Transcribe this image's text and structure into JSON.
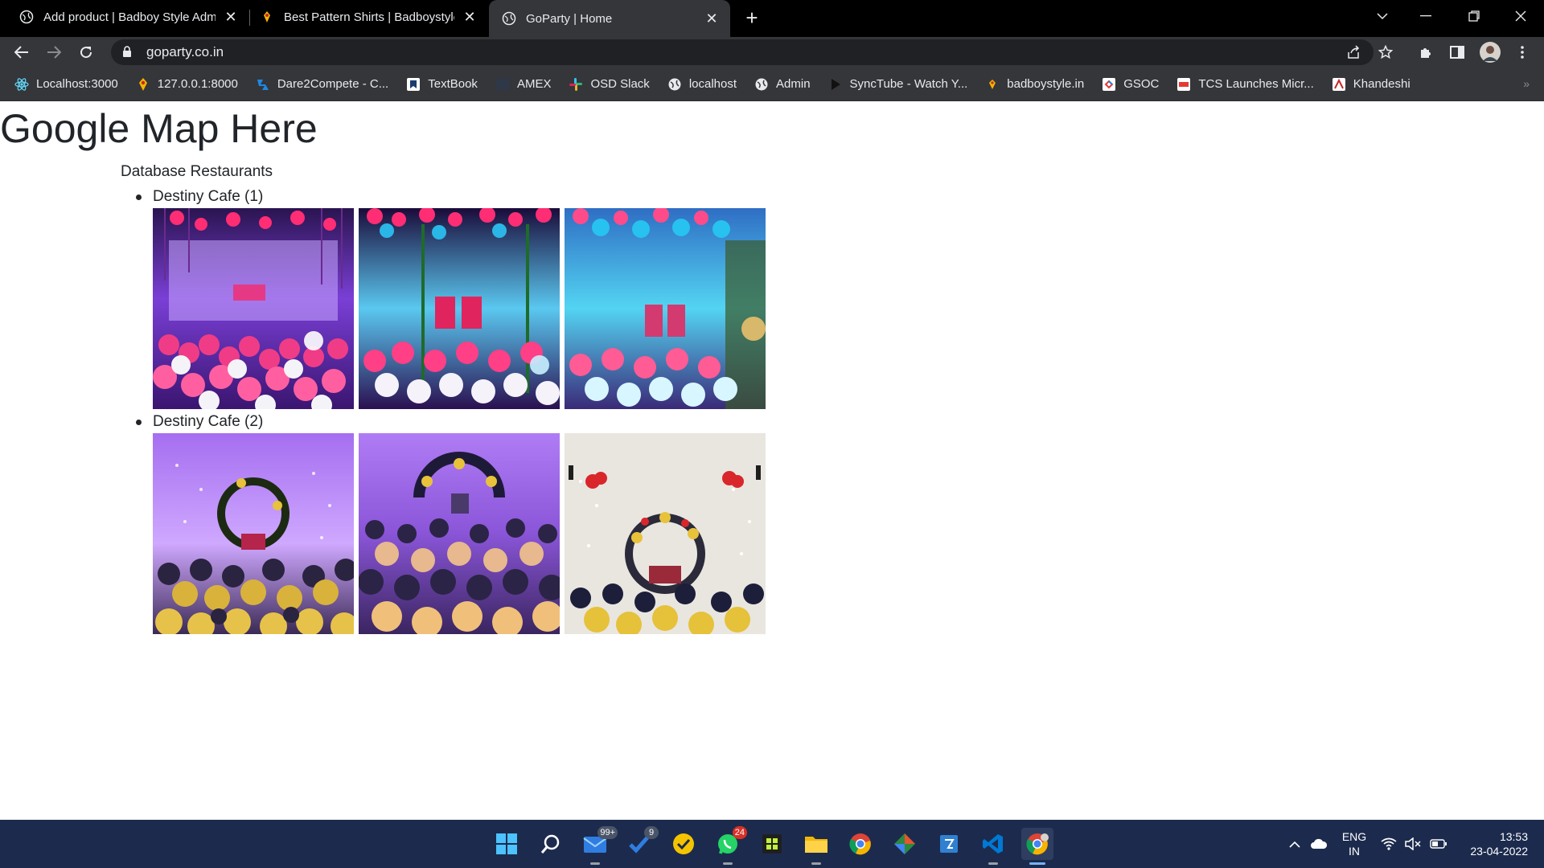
{
  "browser": {
    "tabs": [
      {
        "title": "Add product | Badboy Style Adm",
        "favicon": "globe-icon",
        "active": false
      },
      {
        "title": "Best Pattern Shirts | Badboystyle",
        "favicon": "badboy-icon",
        "active": false
      },
      {
        "title": "GoParty | Home",
        "favicon": "globe-icon",
        "active": true
      }
    ],
    "url": "goparty.co.in",
    "bookmarks": [
      {
        "label": "Localhost:3000",
        "icon": "react-icon"
      },
      {
        "label": "127.0.0.1:8000",
        "icon": "badboy-icon"
      },
      {
        "label": "Dare2Compete - C...",
        "icon": "d2c-icon"
      },
      {
        "label": "TextBook",
        "icon": "textbook-icon"
      },
      {
        "label": "AMEX",
        "icon": "amex-icon"
      },
      {
        "label": "OSD Slack",
        "icon": "slack-icon"
      },
      {
        "label": "localhost",
        "icon": "globe-icon"
      },
      {
        "label": "Admin",
        "icon": "globe-icon"
      },
      {
        "label": "SyncTube - Watch Y...",
        "icon": "play-icon"
      },
      {
        "label": "badboystyle.in",
        "icon": "badboy-icon"
      },
      {
        "label": "GSOC",
        "icon": "gsoc-icon"
      },
      {
        "label": "TCS Launches Micr...",
        "icon": "tcs-icon"
      },
      {
        "label": "Khandeshi",
        "icon": "khandeshi-icon"
      }
    ]
  },
  "page": {
    "heading": "Google Map Here",
    "section_title": "Database Restaurants",
    "restaurants": [
      {
        "name": "Destiny Cafe (1)",
        "photo_theme": "pink-blue-balloons"
      },
      {
        "name": "Destiny Cafe (2)",
        "photo_theme": "gold-black-balloons"
      }
    ]
  },
  "taskbar": {
    "apps": [
      {
        "name": "start-icon"
      },
      {
        "name": "search-icon"
      },
      {
        "name": "mail-icon",
        "badge": "99+"
      },
      {
        "name": "todo-icon",
        "badge": "9"
      },
      {
        "name": "tasks-icon"
      },
      {
        "name": "whatsapp-icon",
        "badge": "24"
      },
      {
        "name": "app-icon"
      },
      {
        "name": "folder-icon"
      },
      {
        "name": "chrome-icon"
      },
      {
        "name": "git-icon"
      },
      {
        "name": "store-icon"
      },
      {
        "name": "vscode-icon"
      },
      {
        "name": "chrome-profile-icon"
      }
    ],
    "lang_top": "ENG",
    "lang_bottom": "IN",
    "time": "13:53",
    "date": "23-04-2022"
  },
  "colors": {
    "tab_bar": "#000000",
    "toolbar": "#35363a",
    "taskbar": "#1c2b4d",
    "text": "#212529"
  }
}
